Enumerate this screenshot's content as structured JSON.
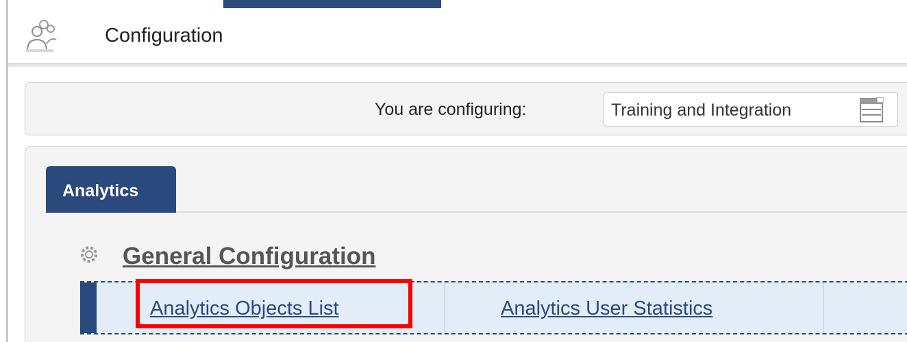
{
  "header": {
    "title": "Configuration",
    "icon": "users-icon"
  },
  "configuring": {
    "label": "You are configuring:",
    "selected": "Training and Integration",
    "picker_icon": "picker-icon"
  },
  "tabs": [
    {
      "label": "Analytics",
      "active": true
    }
  ],
  "section": {
    "title": "General Configuration",
    "icon": "gear-icon",
    "links": [
      {
        "label": "Analytics Objects List",
        "highlighted": true
      },
      {
        "label": "Analytics User Statistics",
        "highlighted": false
      }
    ]
  },
  "colors": {
    "accent": "#2a4a7d",
    "highlight": "#ff0000",
    "link_row_bg": "#e2edf8"
  }
}
